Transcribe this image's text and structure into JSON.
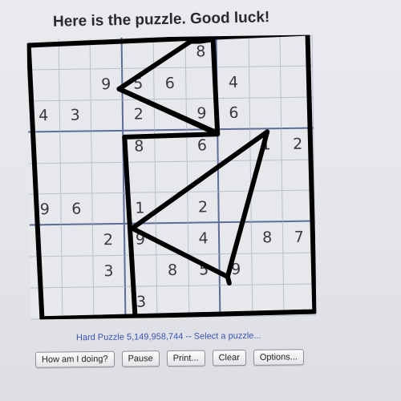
{
  "heading": "Here is the puzzle. Good luck!",
  "puzzle": {
    "grid": [
      [
        "",
        "",
        "",
        "",
        "",
        "8",
        "",
        "",
        ""
      ],
      [
        "",
        "",
        "9",
        "5",
        "6",
        "",
        "4",
        "",
        ""
      ],
      [
        "4",
        "3",
        "",
        "2",
        "",
        "9",
        "6",
        "",
        ""
      ],
      [
        "",
        "",
        "",
        "8",
        "",
        "6",
        "",
        "1",
        "2"
      ],
      [
        "",
        "",
        "",
        "",
        "",
        "",
        "",
        "",
        ""
      ],
      [
        "9",
        "6",
        "",
        "1",
        "",
        "2",
        "",
        "",
        ""
      ],
      [
        "",
        "",
        "2",
        "9",
        "",
        "4",
        "",
        "8",
        "7"
      ],
      [
        "",
        "",
        "3",
        "",
        "8",
        "5",
        "9",
        "",
        ""
      ],
      [
        "",
        "",
        "",
        "3",
        "",
        "",
        "",
        "",
        ""
      ]
    ]
  },
  "caption": {
    "puzzle_label": "Hard Puzzle 5,149,958,744 --",
    "select_link": "Select a puzzle..."
  },
  "buttons": {
    "how_am_i_doing": "How am I doing?",
    "pause": "Pause",
    "print": "Print...",
    "clear": "Clear",
    "options": "Options..."
  },
  "colors": {
    "page_background": "#e6e8ec",
    "grid_line": "#b8c0cc",
    "box_line": "#5c6d97",
    "digit": "#3a3a3e",
    "link": "#3a54b8",
    "marker": "#000000"
  },
  "icons": {
    "overlay": "hand-drawn-marker-overlay"
  }
}
